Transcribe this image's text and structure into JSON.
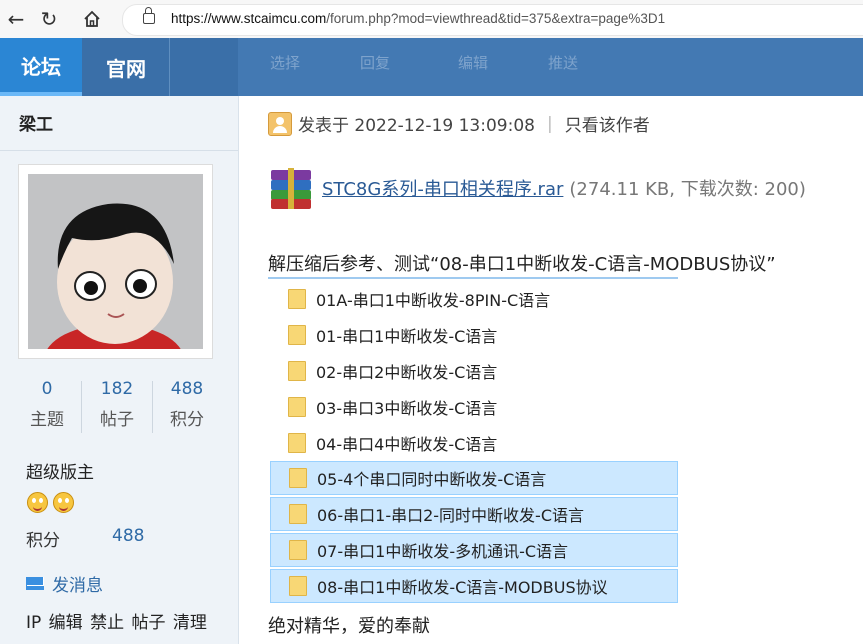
{
  "browser": {
    "url_domain": "https://www.stcaimcu.com",
    "url_path": "/forum.php?mod=viewthread&tid=375&extra=page%3D1"
  },
  "nav": {
    "tabs": [
      "论坛",
      "官网"
    ],
    "ghost_items": [
      "选择",
      "回复",
      "编辑",
      "推送"
    ]
  },
  "sidebar": {
    "username": "梁工",
    "stats": [
      {
        "value": "0",
        "label": "主题"
      },
      {
        "value": "182",
        "label": "帖子"
      },
      {
        "value": "488",
        "label": "积分"
      }
    ],
    "rank": "超级版主",
    "points_label": "积分",
    "points_value": "488",
    "message_link": "发消息",
    "admin_actions": "IP 编辑 禁止 帖子 清理"
  },
  "post": {
    "posted_at": "发表于 2022-12-19 13:09:08",
    "only_author": "只看该作者",
    "attachment": {
      "name": "STC8G系列-串口相关程序.rar",
      "meta": "(274.11 KB, 下载次数: 200)"
    },
    "description": "解压缩后参考、测试“08-串口1中断收发-C语言-MODBUS协议”",
    "files": [
      {
        "name": "01A-串口1中断收发-8PIN-C语言",
        "selected": false
      },
      {
        "name": "01-串口1中断收发-C语言",
        "selected": false
      },
      {
        "name": "02-串口2中断收发-C语言",
        "selected": false
      },
      {
        "name": "03-串口3中断收发-C语言",
        "selected": false
      },
      {
        "name": "04-串口4中断收发-C语言",
        "selected": false
      },
      {
        "name": "05-4个串口同时中断收发-C语言",
        "selected": true
      },
      {
        "name": "06-串口1-串口2-同时中断收发-C语言",
        "selected": true
      },
      {
        "name": "07-串口1中断收发-多机通讯-C语言",
        "selected": true
      },
      {
        "name": "08-串口1中断收发-C语言-MODBUS协议",
        "selected": true
      }
    ],
    "footer": "绝对精华，爱的奉献"
  }
}
